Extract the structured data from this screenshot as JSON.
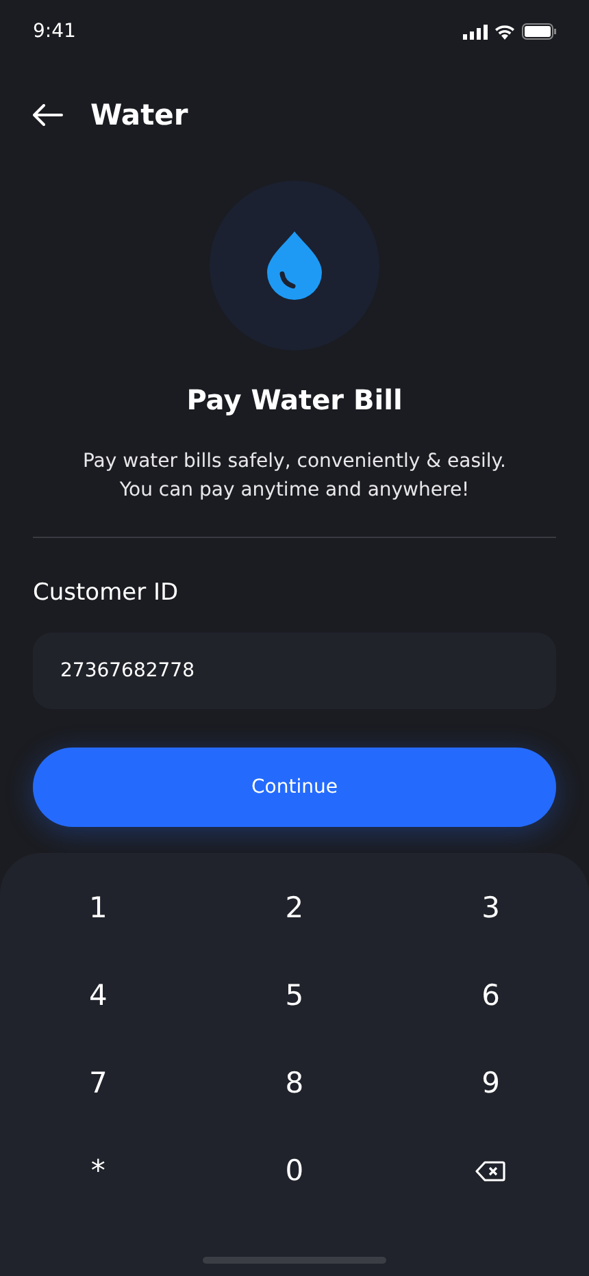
{
  "status_bar": {
    "time": "9:41"
  },
  "header": {
    "title": "Water"
  },
  "hero": {
    "title": "Pay Water Bill",
    "description": "Pay water bills safely, conveniently & easily.\nYou can pay anytime and anywhere!"
  },
  "form": {
    "label": "Customer ID",
    "value": "27367682778",
    "button": "Continue"
  },
  "keypad": [
    {
      "kind": "digit",
      "label": "1"
    },
    {
      "kind": "digit",
      "label": "2"
    },
    {
      "kind": "digit",
      "label": "3"
    },
    {
      "kind": "digit",
      "label": "4"
    },
    {
      "kind": "digit",
      "label": "5"
    },
    {
      "kind": "digit",
      "label": "6"
    },
    {
      "kind": "digit",
      "label": "7"
    },
    {
      "kind": "digit",
      "label": "8"
    },
    {
      "kind": "digit",
      "label": "9"
    },
    {
      "kind": "digit",
      "label": "*"
    },
    {
      "kind": "digit",
      "label": "0"
    },
    {
      "kind": "backspace"
    }
  ]
}
